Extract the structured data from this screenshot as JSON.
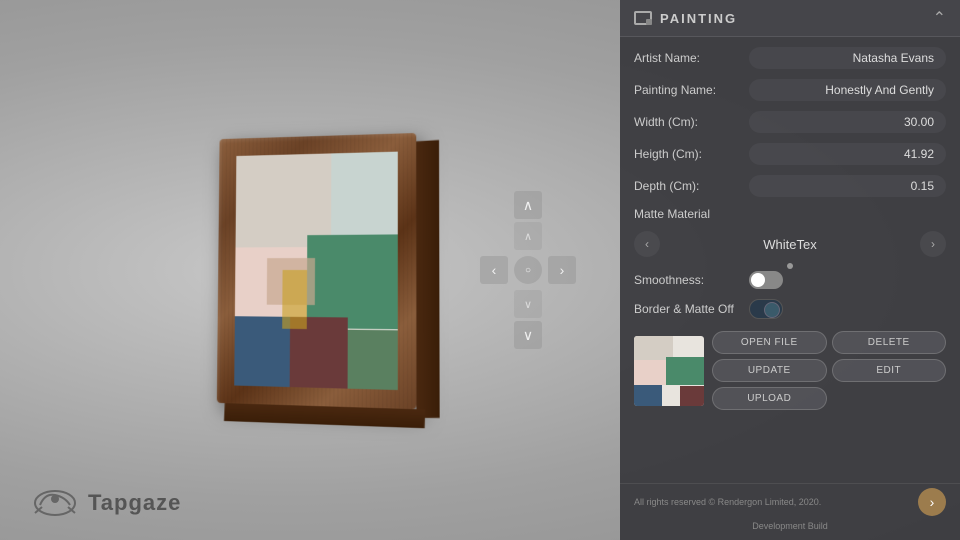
{
  "app": {
    "title": "Tapgaze",
    "logo_text": "Tapgaze"
  },
  "panel": {
    "title": "PAINTING",
    "chevron": "⌃",
    "fields": {
      "artist_label": "Artist Name:",
      "artist_value": "Natasha Evans",
      "painting_label": "Painting Name:",
      "painting_value": "Honestly And Gently",
      "width_label": "Width (Cm):",
      "width_value": "30.00",
      "height_label": "Heigth (Cm):",
      "height_value": "41.92",
      "depth_label": "Depth (Cm):",
      "depth_value": "0.15"
    },
    "matte": {
      "section_label": "Matte Material",
      "material_name": "WhiteTex",
      "left_arrow": "‹",
      "right_arrow": "›"
    },
    "smoothness": {
      "label": "Smoothness:"
    },
    "border_matte": {
      "label": "Border & Matte Off"
    },
    "actions": {
      "open_file": "OPEN FILE",
      "delete": "DELETE",
      "update": "UPDATE",
      "edit": "EDIT",
      "upload": "UPLOAD"
    },
    "footer": {
      "copyright": "All rights reserved © Rendergon Limited, 2020.",
      "dev_text": "Development Build",
      "nav_arrow": "›"
    }
  },
  "viewport": {
    "up_arrow": "∧",
    "down_arrow": "∨",
    "left_arrow": "‹",
    "right_arrow": "›",
    "center_icon": "○"
  }
}
